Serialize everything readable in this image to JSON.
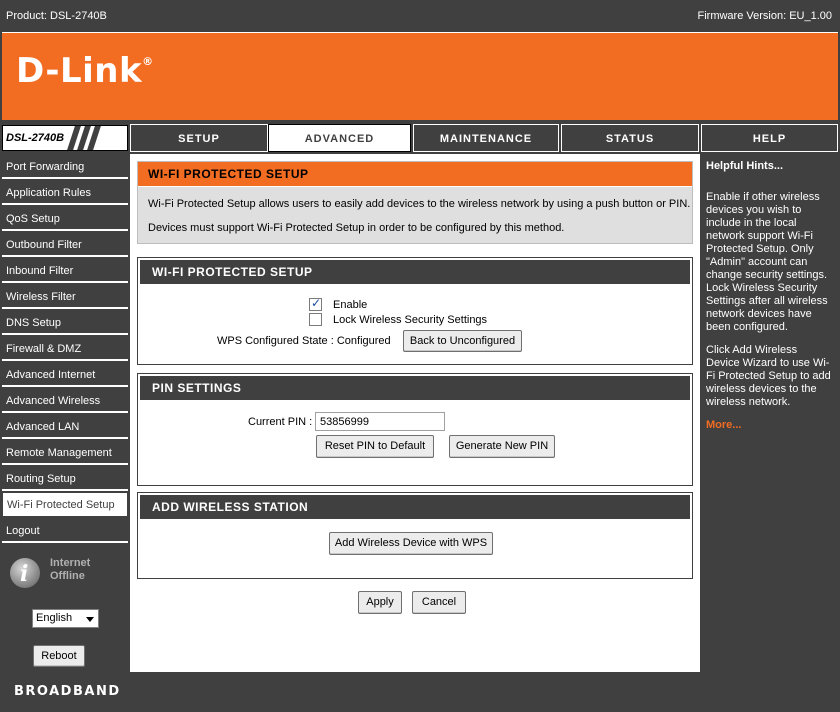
{
  "header": {
    "product": "Product: DSL-2740B",
    "firmware": "Firmware Version: EU_1.00",
    "logo_text": "D-Link",
    "logo_mark": "®"
  },
  "nav": {
    "model": "DSL-2740B",
    "tabs": [
      "SETUP",
      "ADVANCED",
      "MAINTENANCE",
      "STATUS",
      "HELP"
    ],
    "active_tab": "ADVANCED"
  },
  "sidebar": {
    "items": [
      "Port Forwarding",
      "Application Rules",
      "QoS Setup",
      "Outbound Filter",
      "Inbound Filter",
      "Wireless Filter",
      "DNS Setup",
      "Firewall & DMZ",
      "Advanced Internet",
      "Advanced Wireless",
      "Advanced LAN",
      "Remote Management",
      "Routing Setup",
      "Wi-Fi Protected Setup",
      "Logout"
    ],
    "active_item": "Wi-Fi Protected Setup",
    "internet_status_line1": "Internet",
    "internet_status_line2": "Offline",
    "language": "English",
    "reboot_label": "Reboot"
  },
  "intro": {
    "title": "WI-FI PROTECTED SETUP",
    "line1": "Wi-Fi Protected Setup allows users to easily add devices to the wireless network by using a push button or PIN.",
    "line2": "Devices must support Wi-Fi Protected Setup in order to be configured by this method."
  },
  "wps": {
    "title": "WI-FI PROTECTED SETUP",
    "enable_label": "Enable",
    "enable_checked": true,
    "lock_label": "Lock Wireless Security Settings",
    "lock_checked": false,
    "state_label": "WPS Configured State : Configured",
    "back_button": "Back to Unconfigured"
  },
  "pin": {
    "title": "PIN SETTINGS",
    "current_label": "Current PIN :",
    "current_value": "53856999",
    "reset_button": "Reset PIN to Default",
    "generate_button": "Generate New PIN"
  },
  "station": {
    "title": "ADD WIRELESS STATION",
    "add_button": "Add Wireless Device with WPS"
  },
  "actions": {
    "apply": "Apply",
    "cancel": "Cancel"
  },
  "hints": {
    "title": "Helpful Hints...",
    "p1": "Enable if other wireless devices you wish to include in the local network support Wi-Fi Protected Setup. Only \"Admin\" account can change security settings. Lock Wireless Security Settings after all wireless network devices have been configured.",
    "p2": "Click Add Wireless Device Wizard to use Wi-Fi Protected Setup to add wireless devices to the wireless network.",
    "more": "More..."
  },
  "footer": {
    "brand": "BROADBAND"
  },
  "colors": {
    "brand_orange": "#f26c22",
    "dark_gray": "#404040"
  }
}
